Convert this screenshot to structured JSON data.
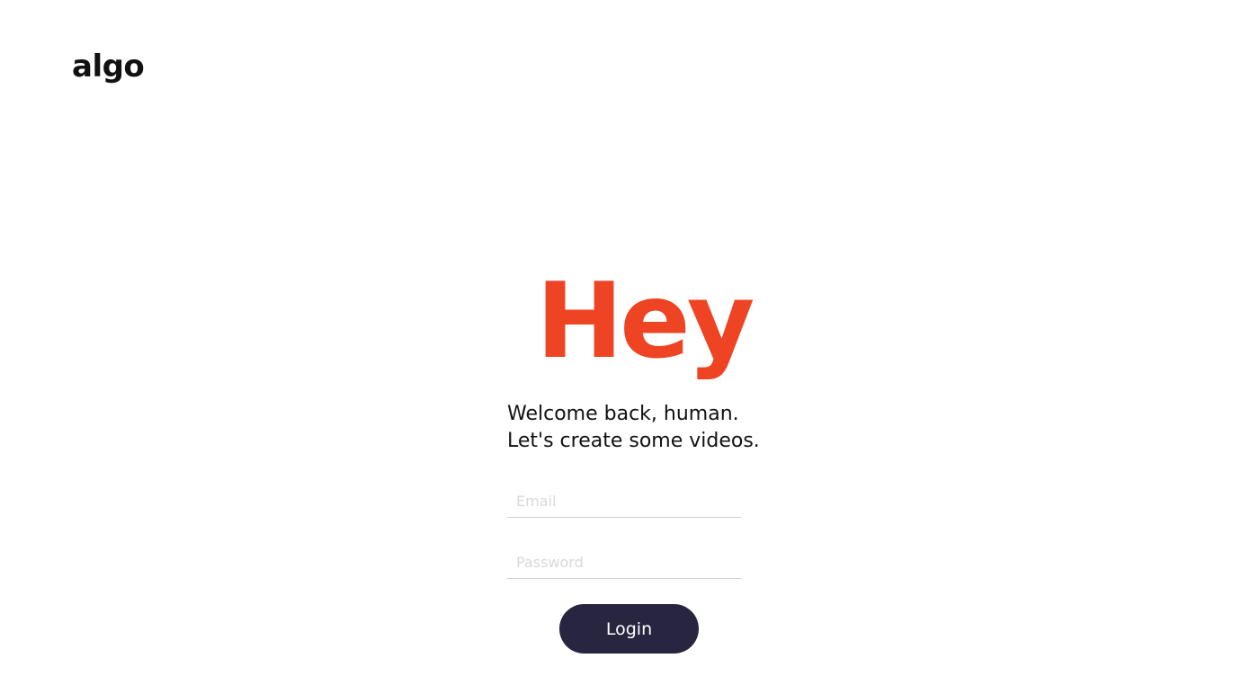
{
  "brand": {
    "logo_text": "algo",
    "accent_color": "#EF4423",
    "button_color": "#282541"
  },
  "hero": {
    "heading": "Hey",
    "line1": "Welcome back, human.",
    "line2": "Let's create some videos."
  },
  "form": {
    "email_placeholder": "Email",
    "password_placeholder": "Password",
    "login_label": "Login"
  }
}
